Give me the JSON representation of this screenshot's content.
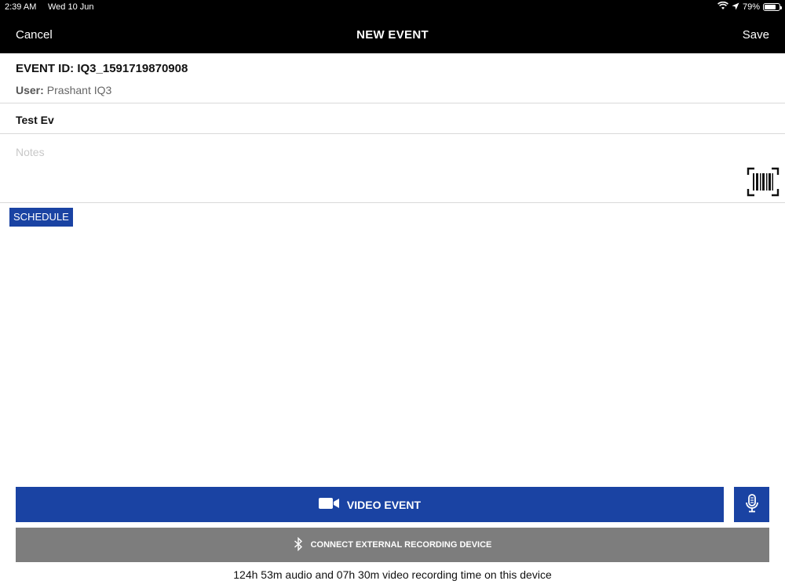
{
  "status_bar": {
    "time": "2:39 AM",
    "date": "Wed 10 Jun",
    "battery": "79%",
    "battery_level": 0.79,
    "icons": [
      "wifi-icon",
      "location-arrow-icon",
      "battery-icon"
    ]
  },
  "nav": {
    "cancel_label": "Cancel",
    "title": "NEW EVENT",
    "save_label": "Save"
  },
  "event": {
    "id_text": "EVENT ID: IQ3_1591719870908",
    "user_label": "User:",
    "user_value": "Prashant IQ3",
    "title_value": "Test Ev",
    "notes_placeholder": "Notes"
  },
  "schedule_label": "SCHEDULE",
  "buttons": {
    "video_event": "VIDEO EVENT",
    "connect_device": "CONNECT EXTERNAL RECORDING DEVICE"
  },
  "recording_time": "124h 53m audio and 07h 30m video recording time on this device",
  "colors": {
    "accent_blue": "#1a43a3",
    "gray_button": "#7d7d7d",
    "topbar": "#000000"
  }
}
